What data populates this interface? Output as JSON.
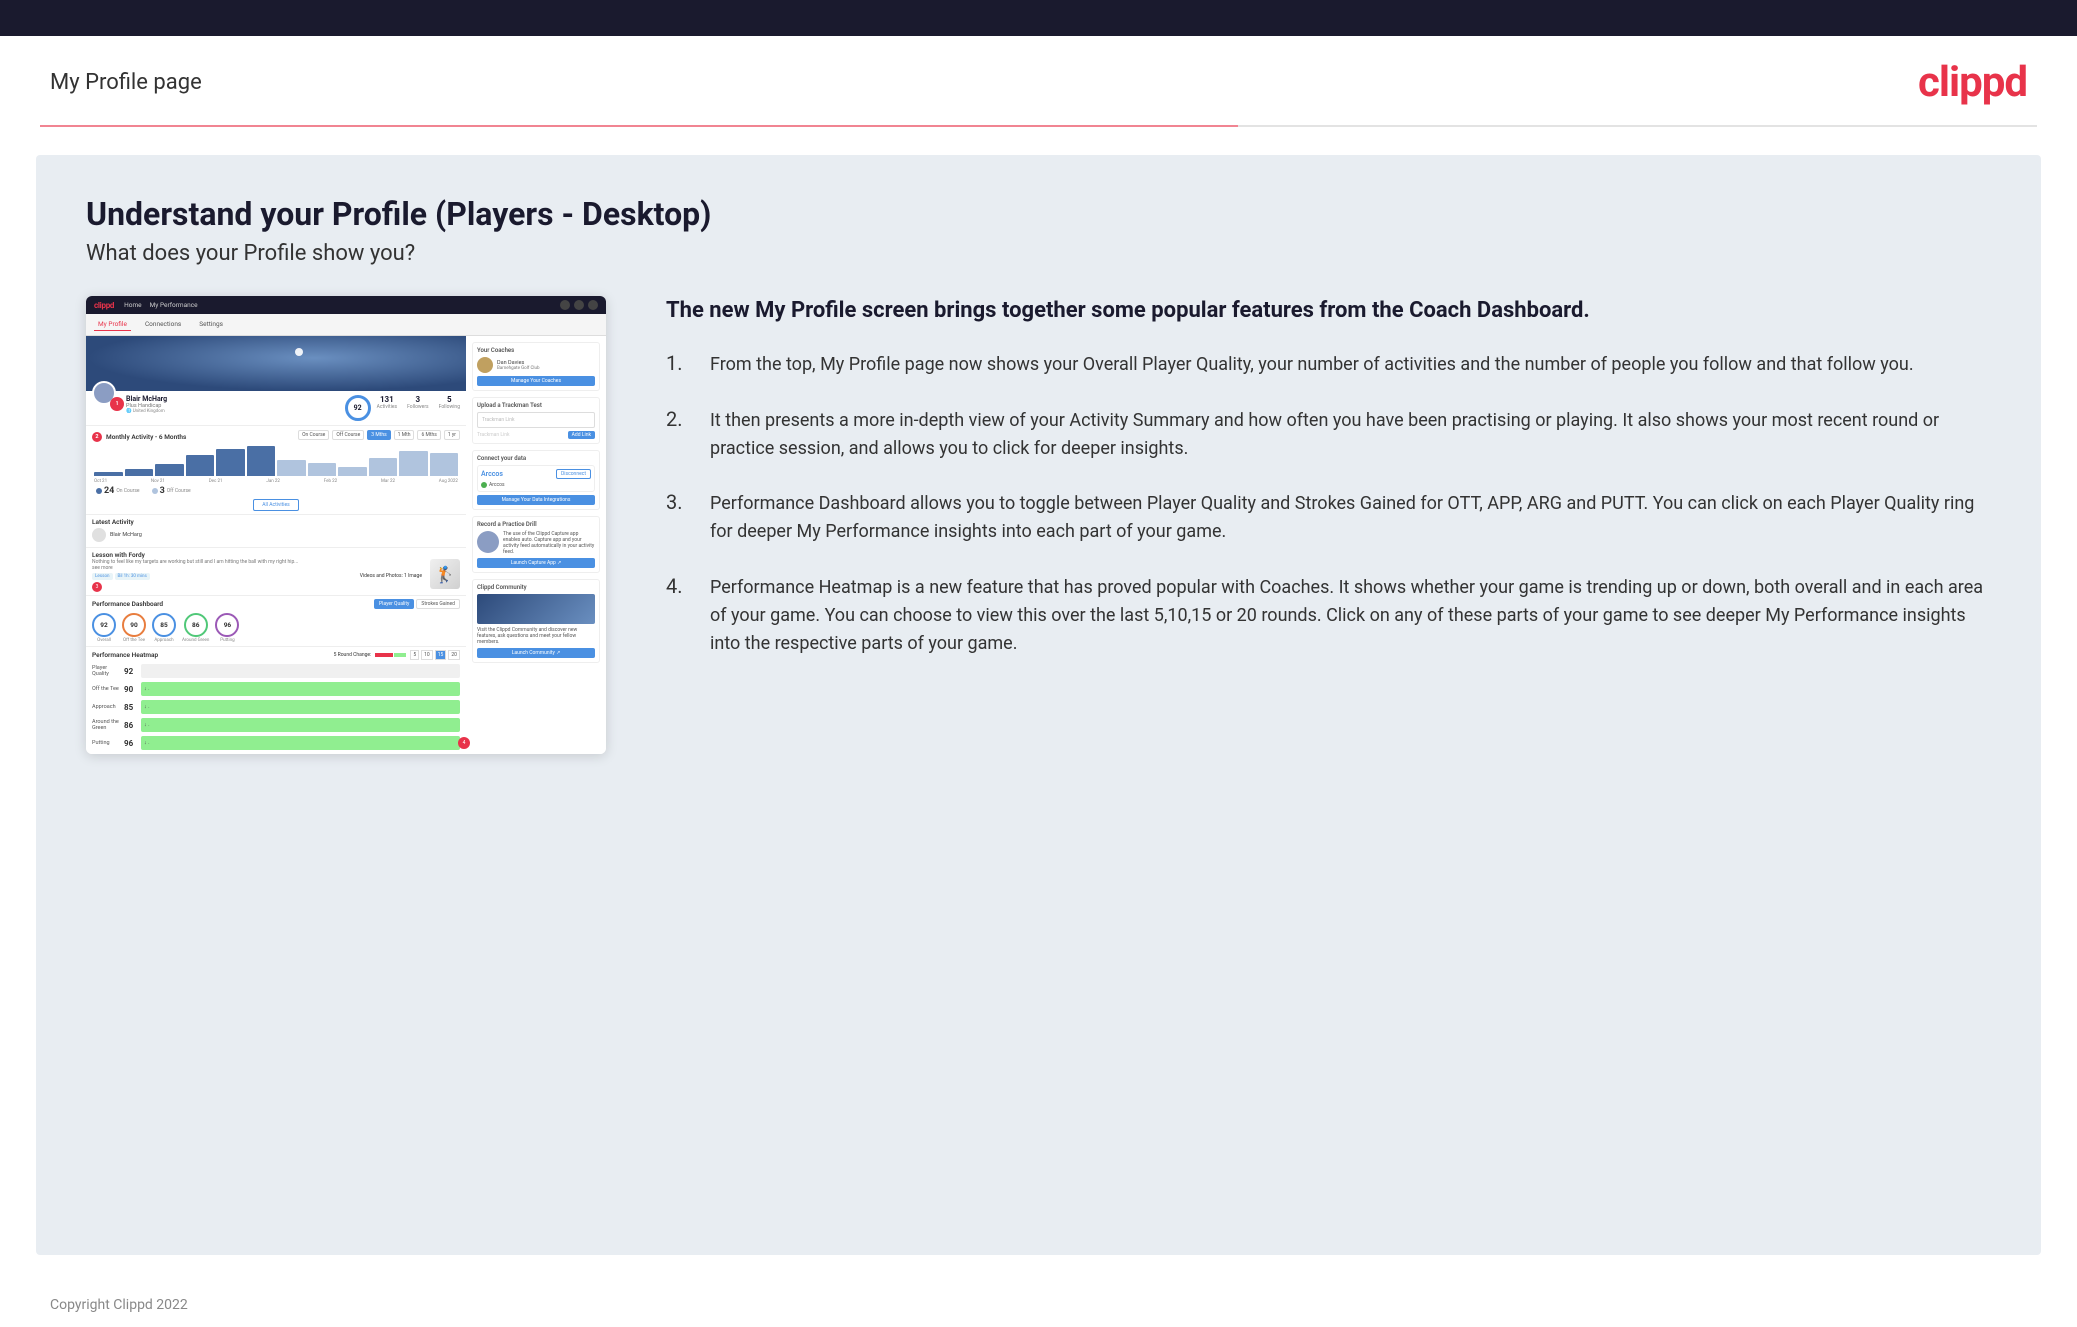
{
  "header": {
    "title": "My Profile page",
    "logo": "clippd"
  },
  "main": {
    "title": "Understand your Profile (Players - Desktop)",
    "subtitle": "What does your Profile show you?",
    "right_title": "The new My Profile screen brings together some popular features from the Coach Dashboard.",
    "list_items": [
      {
        "num": "1.",
        "text": "From the top, My Profile page now shows your Overall Player Quality, your number of activities and the number of people you follow and that follow you."
      },
      {
        "num": "2.",
        "text": "It then presents a more in-depth view of your Activity Summary and how often you have been practising or playing. It also shows your most recent round or practice session, and allows you to click for deeper insights."
      },
      {
        "num": "3.",
        "text": "Performance Dashboard allows you to toggle between Player Quality and Strokes Gained for OTT, APP, ARG and PUTT. You can click on each Player Quality ring for deeper My Performance insights into each part of your game."
      },
      {
        "num": "4.",
        "text": "Performance Heatmap is a new feature that has proved popular with Coaches. It shows whether your game is trending up or down, both overall and in each area of your game. You can choose to view this over the last 5,10,15 or 20 rounds. Click on any of these parts of your game to see deeper My Performance insights into the respective parts of your game."
      }
    ]
  },
  "mockup": {
    "nav": {
      "logo": "clippd",
      "items": [
        "Home",
        "My Performance"
      ],
      "subnav": [
        "My Profile",
        "Connections",
        "Settings"
      ]
    },
    "profile": {
      "name": "Blair McHarg",
      "handicap": "Plus Handicap",
      "quality": "92",
      "activities": "131",
      "followers": "3",
      "following": "5"
    },
    "activity": {
      "title": "Monthly Activity - 6 Months",
      "oncourse": "24",
      "offcourse": "3",
      "bars": [
        4,
        8,
        12,
        22,
        28,
        30,
        18,
        14,
        10,
        20,
        28,
        25
      ]
    },
    "performance": {
      "rings": [
        {
          "value": "92",
          "label": "Overall",
          "color": "#4a90e2"
        },
        {
          "value": "90",
          "label": "Off the Tee",
          "color": "#e87d3e"
        },
        {
          "value": "85",
          "label": "Approach",
          "color": "#4a90e2"
        },
        {
          "value": "86",
          "label": "Around the Green",
          "color": "#50c878"
        },
        {
          "value": "96",
          "label": "Putting",
          "color": "#9b59b6"
        }
      ]
    },
    "heatmap": {
      "rows": [
        {
          "label": "Player Quality",
          "value": "92",
          "color": "#f0f0f0"
        },
        {
          "label": "Off the Tee",
          "value": "90",
          "color": "#90ee90"
        },
        {
          "label": "Approach",
          "value": "85",
          "color": "#90ee90"
        },
        {
          "label": "Around the Green",
          "value": "86",
          "color": "#90ee90"
        },
        {
          "label": "Putting",
          "value": "96",
          "color": "#90ee90"
        }
      ]
    },
    "coaches": {
      "title": "Your Coaches",
      "name": "Dan Davies",
      "club": "Barnehgate Golf Club",
      "btn": "Manage Your Coaches"
    },
    "trackman": {
      "title": "Upload a Trackman Test",
      "placeholder": "Trackman Link",
      "btn": "Add Link"
    },
    "connect": {
      "title": "Connect your data",
      "logo": "Arccos",
      "btn": "Disconnect",
      "manage_btn": "Manage Your Data Integrations"
    },
    "practice": {
      "title": "Record a Practice Drill",
      "btn": "Launch Capture App"
    },
    "community": {
      "title": "Clippd Community",
      "btn": "Launch Community"
    }
  },
  "footer": {
    "text": "Copyright Clippd 2022"
  }
}
